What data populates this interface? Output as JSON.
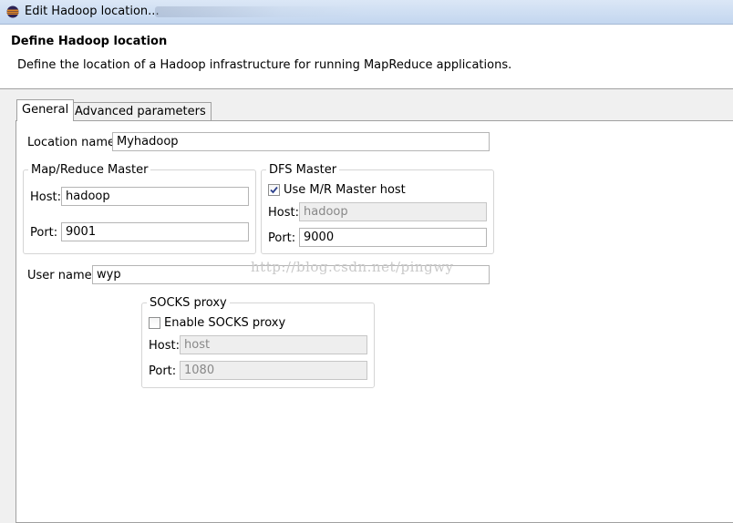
{
  "window": {
    "title": "Edit Hadoop location...",
    "icon": "eclipse-icon"
  },
  "header": {
    "title": "Define Hadoop location",
    "description": "Define the location of a Hadoop infrastructure for running MapReduce applications."
  },
  "tabs": [
    {
      "label": "General",
      "selected": true
    },
    {
      "label": "Advanced parameters",
      "selected": false
    }
  ],
  "general": {
    "location_name": {
      "label": "Location name:",
      "value": "Myhadoop"
    },
    "mapreduce_master": {
      "legend": "Map/Reduce Master",
      "host_label": "Host:",
      "host_value": "hadoop",
      "port_label": "Port:",
      "port_value": "9001"
    },
    "dfs_master": {
      "legend": "DFS Master",
      "use_mr_host_label": "Use M/R Master host",
      "use_mr_host_checked": true,
      "host_label": "Host:",
      "host_value": "hadoop",
      "port_label": "Port:",
      "port_value": "9000"
    },
    "user_name": {
      "label": "User name:",
      "value": "wyp"
    },
    "socks_proxy": {
      "legend": "SOCKS proxy",
      "enable_label": "Enable SOCKS proxy",
      "enable_checked": false,
      "host_label": "Host:",
      "host_value": "host",
      "port_label": "Port:",
      "port_value": "1080"
    }
  },
  "watermark": "http://blog.csdn.net/pingwy"
}
